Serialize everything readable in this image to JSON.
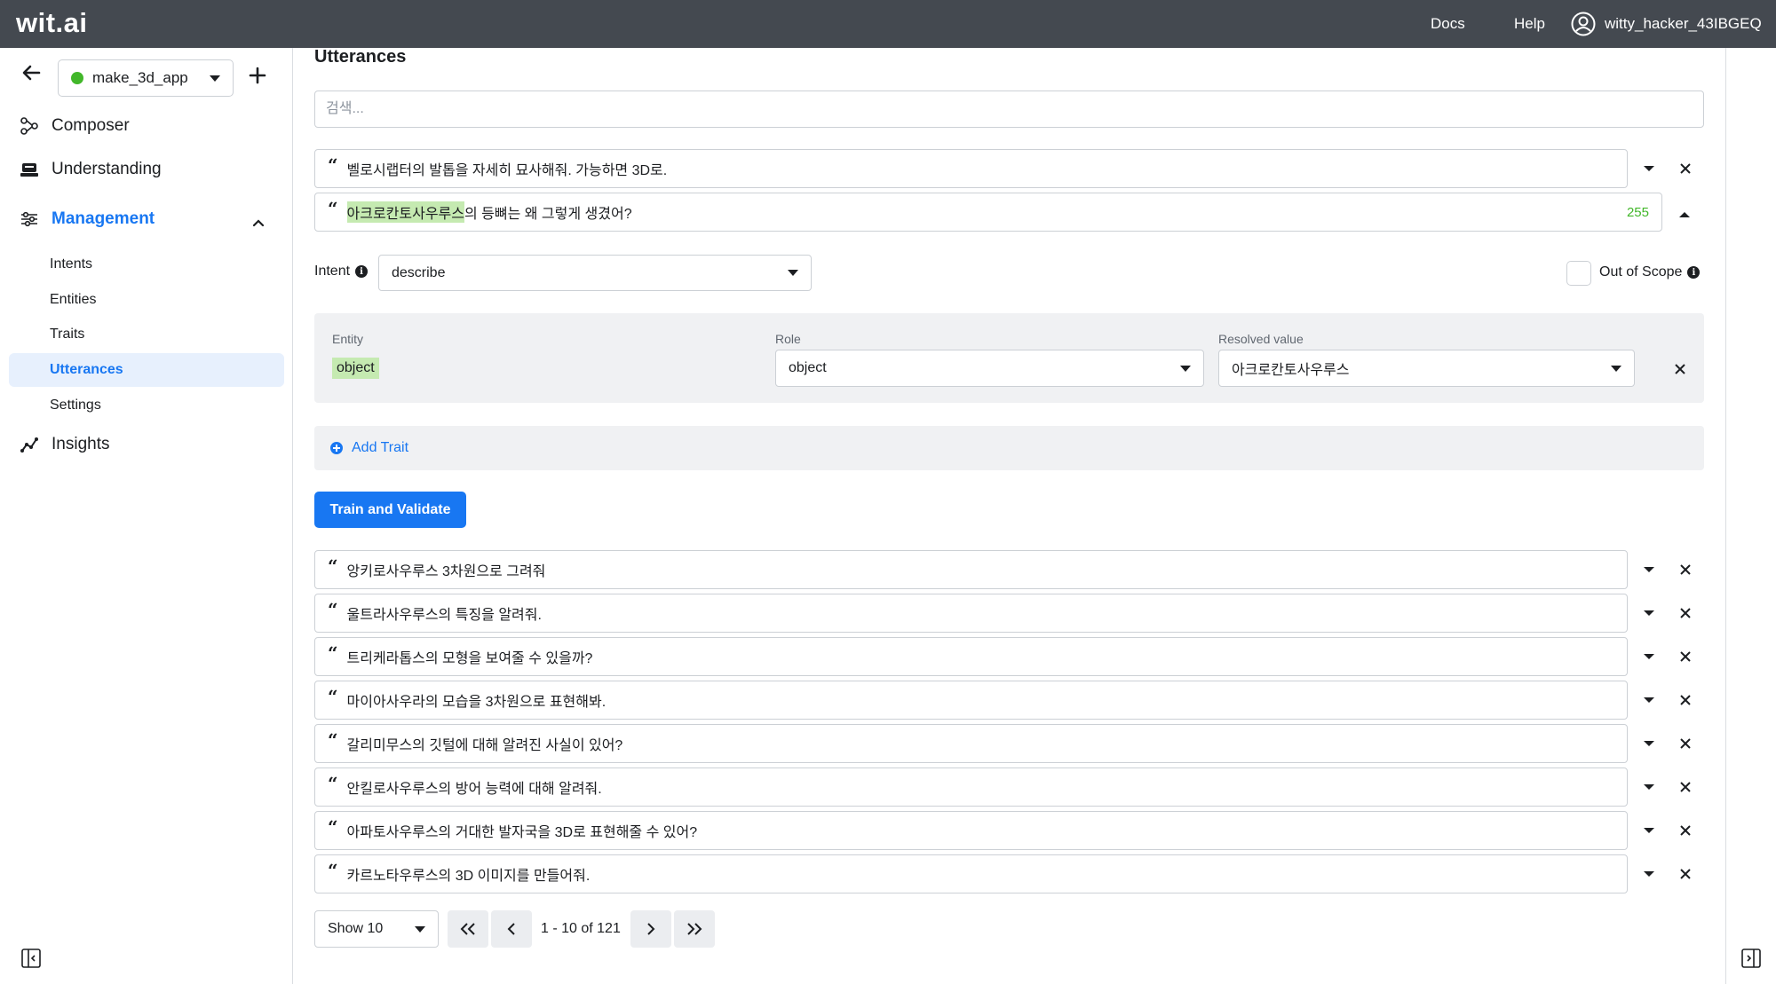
{
  "topbar": {
    "brand": "wit.ai",
    "docs_label": "Docs",
    "help_label": "Help",
    "username": "witty_hacker_43IBGEQ"
  },
  "sidebar": {
    "app_name": "make_3d_app",
    "app_status_color": "#42b72a",
    "nav": {
      "composer": "Composer",
      "understanding": "Understanding",
      "management": "Management",
      "insights": "Insights"
    },
    "management_items": {
      "intents": "Intents",
      "entities": "Entities",
      "traits": "Traits",
      "utterances": "Utterances",
      "settings": "Settings"
    },
    "active_item": "Utterances"
  },
  "main": {
    "title": "Utterances",
    "search_placeholder": "검색...",
    "top_utterance": "벨로시랩터의 발톱을 자세히 묘사해줘. 가능하면 3D로.",
    "open_utterance": {
      "highlight": "아크로칸토사우루스",
      "rest": "의 등뼈는 왜 그렇게 생겼어?",
      "char_count": "255"
    },
    "intent_label": "Intent",
    "intent_value": "describe",
    "out_of_scope_label": "Out of Scope",
    "entity_panel": {
      "entity_header": "Entity",
      "role_header": "Role",
      "resolved_header": "Resolved value",
      "entity_value": "object",
      "role_value": "object",
      "resolved_value": "아크로칸토사우루스"
    },
    "add_trait_label": "Add Trait",
    "train_button_label": "Train and Validate",
    "utterances": [
      "앙키로사우루스 3차원으로 그려줘",
      "울트라사우루스의 특징을 알려줘.",
      "트리케라톱스의  모형을 보여줄 수 있을까?",
      "마이아사우라의 모습을 3차원으로 표현해봐.",
      "갈리미무스의 깃털에 대해 알려진 사실이 있어?",
      "안킬로사우루스의 방어 능력에 대해 알려줘.",
      "아파토사우루스의 거대한 발자국을 3D로 표현해줄 수 있어?",
      "카르노타우루스의 3D 이미지를 만들어줘."
    ],
    "pagination": {
      "show_label": "Show 10",
      "range_text": "1 - 10 of 121"
    }
  },
  "colors": {
    "topbar": "#444950",
    "accent": "#1877f2",
    "highlight": "#c5eab1",
    "count_green": "#42b72a"
  }
}
